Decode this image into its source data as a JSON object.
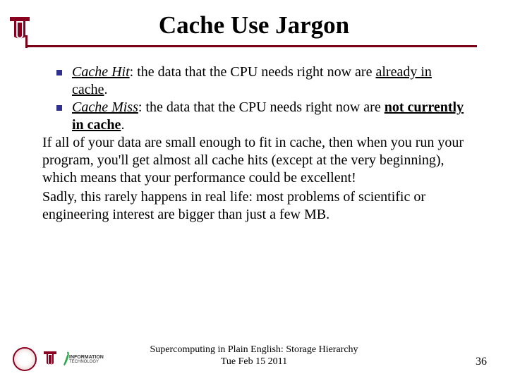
{
  "title": "Cache Use Jargon",
  "bullets": [
    {
      "term": "Cache Hit",
      "sep": ":  ",
      "text_before": "the data that the CPU needs right now are ",
      "emph": "already in cache",
      "text_after": "."
    },
    {
      "term": "Cache Miss",
      "sep": ": ",
      "text_before": "the data that the CPU needs right now are ",
      "emph": "not currently in cache",
      "text_after": "."
    }
  ],
  "para1": "If all of your data are small enough to fit in cache, then when you run your program, you'll get almost all cache hits (except at the very beginning), which means that your performance could be excellent!",
  "para2": "Sadly, this rarely happens in real life: most problems of scientific or engineering interest are bigger than just a few MB.",
  "footer": {
    "line1": "Supercomputing in Plain English: Storage Hierarchy",
    "line2": "Tue Feb 15 2011"
  },
  "pagenum": "36",
  "logos": {
    "it_line1": "INFORMATION",
    "it_line2": "TECHNOLOGY"
  }
}
